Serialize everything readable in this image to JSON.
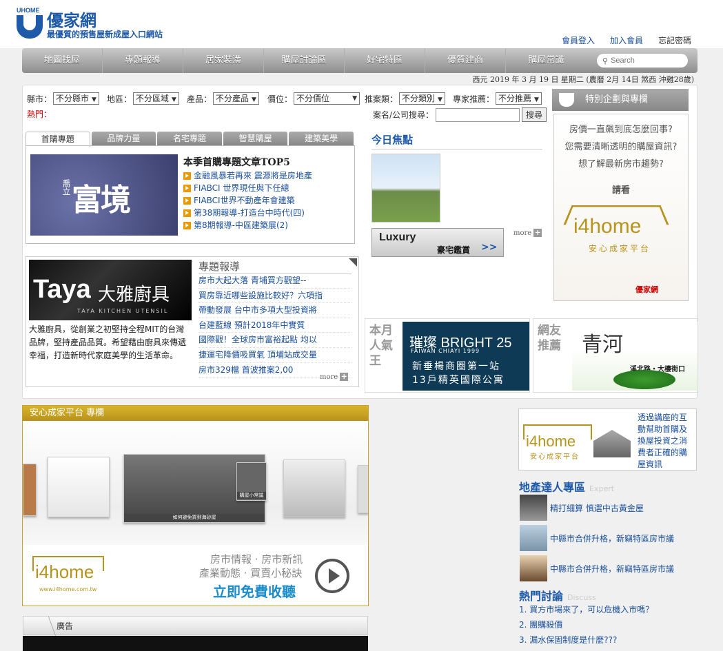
{
  "header": {
    "logo_small": "UHOME",
    "logo_title": "優家網",
    "logo_subtitle": "最優質的預售屋新成屋入口網站",
    "links": [
      "會員登入",
      "加入會員",
      "忘記密碼"
    ]
  },
  "nav": {
    "items": [
      "地圖找屋",
      "專題報導",
      "居家裝潢",
      "購屋討論區",
      "好宅特區",
      "優質建商",
      "購屋常識"
    ],
    "search_placeholder": "Search"
  },
  "date_line": "西元 2019 年 3 月 19 日 星期二 (農曆 2月 14日 煞西 沖雞28歲)",
  "filters": {
    "county_label": "縣市：",
    "county_value": "不分縣市",
    "area_label": "地區：",
    "area_value": "不分區域",
    "product_label": "產品：",
    "product_value": "不分產品",
    "price_label": "價位：",
    "price_value": "不分價位",
    "category_label": "推案類：",
    "category_value": "不分類別",
    "expert_label": "專家推薦：",
    "expert_value": "不分推薦",
    "hot_label": "熱門：",
    "case_search_label": "案名/公司搜尋：",
    "case_search_button": "搜尋"
  },
  "tabs": [
    "首購專題",
    "品牌力量",
    "名宅專題",
    "智慧購屋",
    "建築美學"
  ],
  "topic": {
    "image_text": "富境",
    "image_text_small": "喬立",
    "title": "本季首購專題文章TOP5",
    "items": [
      "金融風暴若再來 震源將是房地產",
      "FIABCI 世界現任與下任總",
      "FIABCI世界不動產年會建築",
      "第38期報導-打造台中時代(四)",
      "第8期報導-中區建築展(2)"
    ]
  },
  "focus": {
    "title": "今日焦點",
    "luxury_en": "Luxury",
    "luxury_zh": "豪宅鑑賞",
    "luxury_arrow": ">>",
    "more": "more"
  },
  "special": {
    "head": "特別企劃與專欄",
    "q1": "房價一直飆到底怎麼回事?",
    "q2": "您需要清晰透明的購屋資訊?",
    "q3": "想了解最新房市趨勢?",
    "see": "請看",
    "brand": "i4home",
    "platform": "安心成家平台",
    "brand2": "優家網"
  },
  "taya": {
    "logo_en": "Taya",
    "logo_zh": "大雅廚具",
    "logo_sub": "TAYA KITCHEN UTENSIL",
    "desc": "大雅廚具，從創業之初堅持全程MIT的台灣品牌，堅持產品品質。希望藉由廚具來傳遞幸福，打造新時代家庭美學的生活革命。"
  },
  "report": {
    "title": "專題報導",
    "items": [
      "房市大起大落 青埔買方觀望--",
      "買房靠近哪些設施比較好？六項指",
      "帶動發展 台中市多項大型投資將",
      "台建藍線 預計2018年中實質",
      "國際觀！全球房市富裕起點 均以",
      "捷運宅降價吸買氣 頂埔站成交量",
      "房市329檔 首波推案2,00"
    ],
    "more": "more"
  },
  "month": {
    "label": "本月人氣王",
    "b1": "璀璨 BRIGHT 25",
    "b2": "FAIWAN CHIAYI 1999",
    "b3": "新垂楊商圈第一站",
    "b4": "13戶精英國際公寓"
  },
  "friend": {
    "label": "網友推薦",
    "g1": "青河",
    "g2": "溪北路・大樓街口"
  },
  "column": {
    "head": "安心成家平台 專欄",
    "thumb_cap1": "如何避免買到海砂屋",
    "thumb_cap2": "購屋小常識",
    "brand": "i4home",
    "url": "www.i4home.com.tw",
    "t1": "房市情報 · 房市新訊",
    "t2": "產業動態 · 買賣小秘訣",
    "t3": "立即免費收聽"
  },
  "ad": {
    "head": "廣告"
  },
  "right": {
    "i4_brand": "i4home",
    "i4_platform": "安心成家平台",
    "i4_text": "透過講座的互動幫助首購及換屋投資之消費者正確的購屋資訊",
    "expert_title": "地產達人專區",
    "expert_en": "Expert",
    "experts": [
      "精打細算 慎選中古黃金屋",
      "中縣市合併升格，新竊特區房市議",
      "中縣市合併升格，新竊特區房市議"
    ],
    "discuss_title": "熱門討論",
    "discuss_en": "Discuss",
    "discuss": [
      "1. 買方市場來了，可以危機入市嗎？",
      "2. 團購殺價",
      "3. 漏水保固制度是什麼???"
    ]
  }
}
